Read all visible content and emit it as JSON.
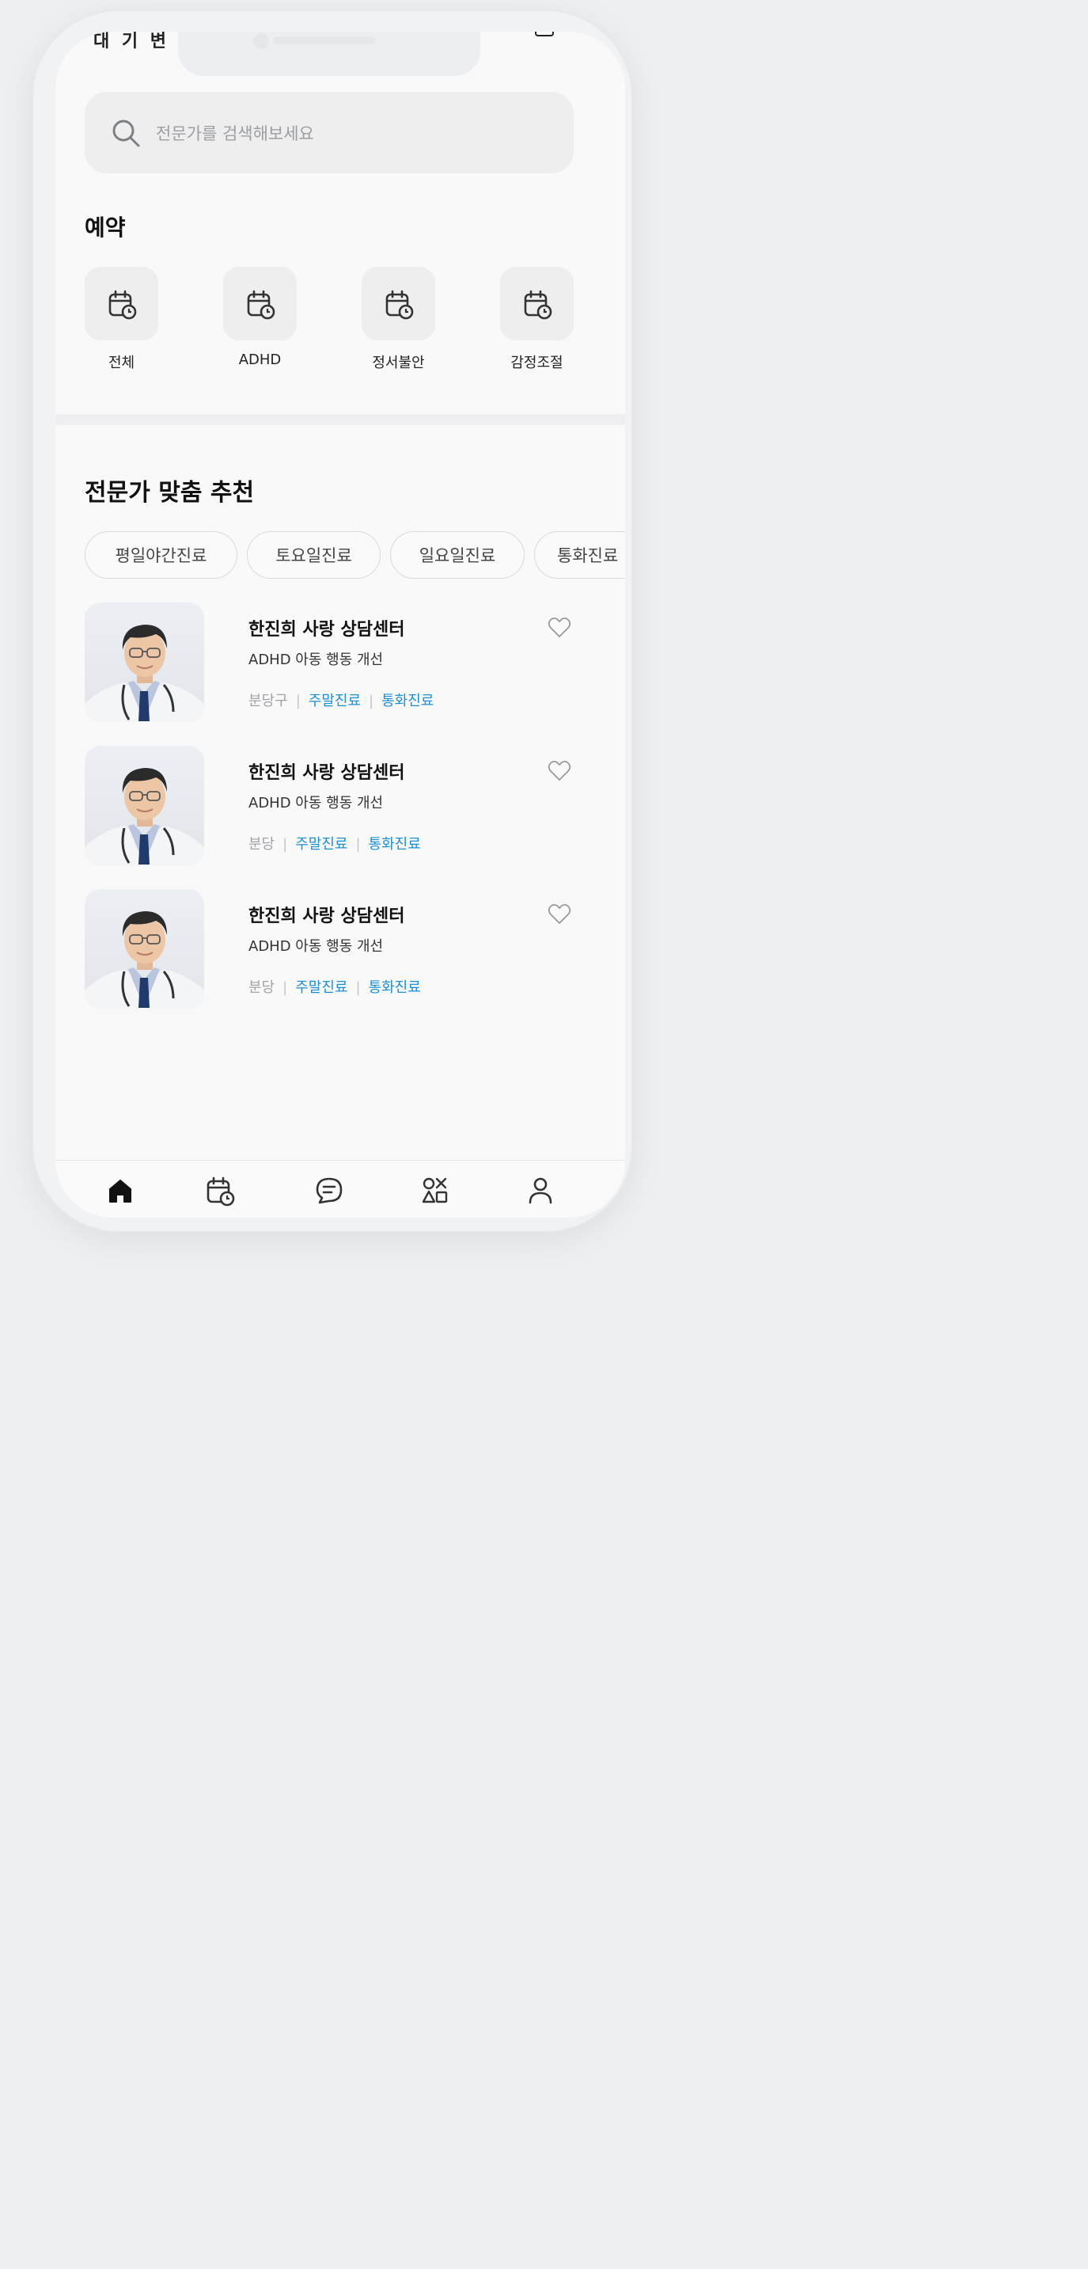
{
  "status": {
    "cut_text": "대 기 변"
  },
  "search": {
    "placeholder": "전문가를 검색해보세요",
    "icon": "search-icon"
  },
  "booking": {
    "title": "예약",
    "categories": [
      {
        "label": "전체",
        "icon": "calendar-clock-icon"
      },
      {
        "label": "ADHD",
        "icon": "calendar-clock-icon"
      },
      {
        "label": "정서불안",
        "icon": "calendar-clock-icon"
      },
      {
        "label": "감정조절",
        "icon": "calendar-clock-icon"
      }
    ]
  },
  "recommend": {
    "title": "전문가 맞춤 추천",
    "chips": [
      "평일야간진료",
      "토요일진료",
      "일요일진료",
      "통화진료"
    ],
    "experts": [
      {
        "name": "한진희 사랑 상담센터",
        "desc": "ADHD 아동 행동 개선",
        "location": "분당구",
        "tags": [
          "주말진료",
          "통화진료"
        ]
      },
      {
        "name": "한진희 사랑 상담센터",
        "desc": "ADHD 아동 행동 개선",
        "location": "분당",
        "tags": [
          "주말진료",
          "통화진료"
        ]
      },
      {
        "name": "한진희 사랑 상담센터",
        "desc": "ADHD 아동 행동 개선",
        "location": "분당",
        "tags": [
          "주말진료",
          "통화진료"
        ]
      }
    ]
  },
  "tabbar": {
    "items": [
      {
        "icon": "home-icon"
      },
      {
        "icon": "calendar-clock-icon"
      },
      {
        "icon": "chat-icon"
      },
      {
        "icon": "shapes-icon"
      },
      {
        "icon": "person-icon"
      }
    ]
  },
  "colors": {
    "accent": "#1d8fd6",
    "background": "#f9f9fa",
    "card_bg": "#eeeeef"
  }
}
